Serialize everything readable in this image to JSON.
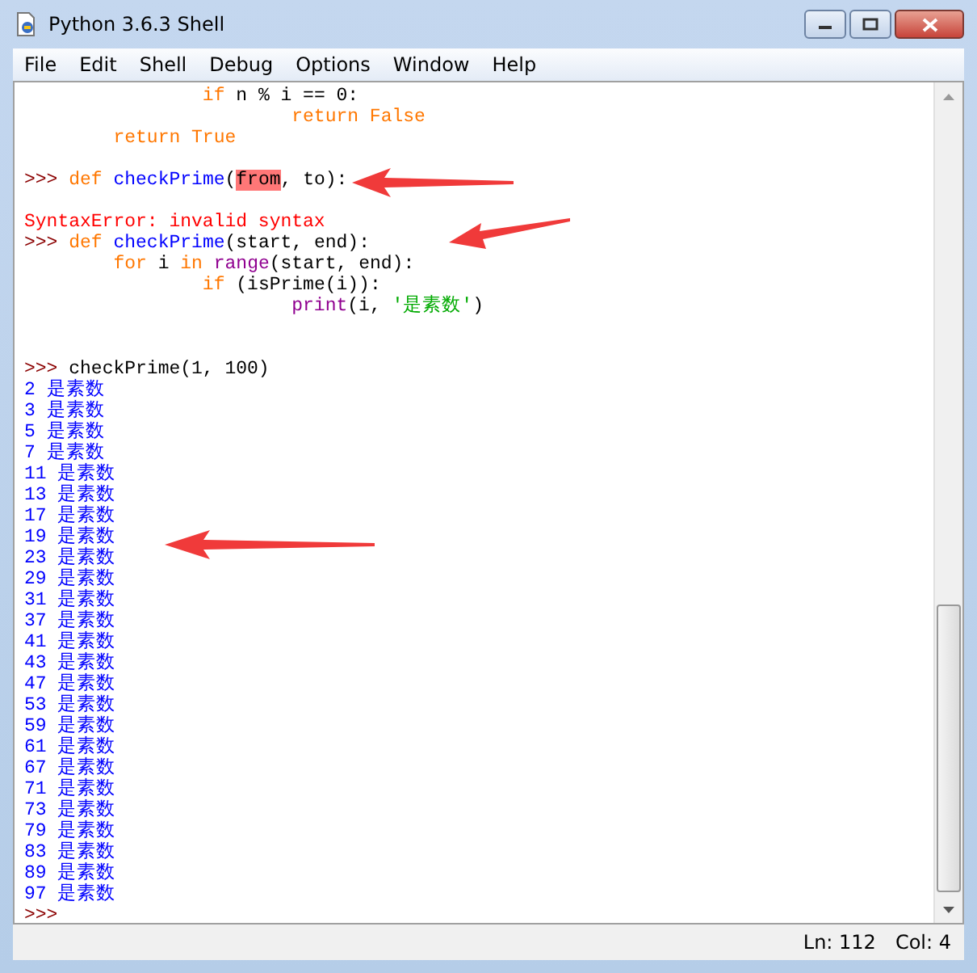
{
  "window": {
    "title": "Python 3.6.3 Shell"
  },
  "menu": [
    "File",
    "Edit",
    "Shell",
    "Debug",
    "Options",
    "Window",
    "Help"
  ],
  "lines": [
    {
      "kind": "code",
      "segments": [
        {
          "text": "                if",
          "kind": "keyword"
        },
        {
          "text": " n % i == 0:",
          "kind": "plain"
        }
      ]
    },
    {
      "kind": "code",
      "segments": [
        {
          "text": "                        return False",
          "kind": "keyword"
        }
      ]
    },
    {
      "kind": "code",
      "segments": [
        {
          "text": "        return True",
          "kind": "keyword"
        }
      ]
    },
    {
      "kind": "blank"
    },
    {
      "kind": "code",
      "segments": [
        {
          "text": ">>> ",
          "kind": "prompt"
        },
        {
          "text": "def",
          "kind": "keyword"
        },
        {
          "text": " checkPrime",
          "kind": "definition"
        },
        {
          "text": "(",
          "kind": "plain"
        },
        {
          "text": "from",
          "kind": "error-mark"
        },
        {
          "text": ", to):",
          "kind": "plain"
        }
      ]
    },
    {
      "kind": "blank"
    },
    {
      "kind": "code",
      "segments": [
        {
          "text": "SyntaxError: invalid syntax",
          "kind": "error"
        }
      ]
    },
    {
      "kind": "code",
      "segments": [
        {
          "text": ">>> ",
          "kind": "prompt"
        },
        {
          "text": "def",
          "kind": "keyword"
        },
        {
          "text": " checkPrime",
          "kind": "definition"
        },
        {
          "text": "(start, end):",
          "kind": "plain"
        }
      ]
    },
    {
      "kind": "code",
      "segments": [
        {
          "text": "        for",
          "kind": "keyword"
        },
        {
          "text": " i ",
          "kind": "plain"
        },
        {
          "text": "in ",
          "kind": "keyword"
        },
        {
          "text": "range",
          "kind": "builtin"
        },
        {
          "text": "(start, end):",
          "kind": "plain"
        }
      ]
    },
    {
      "kind": "code",
      "segments": [
        {
          "text": "                if",
          "kind": "keyword"
        },
        {
          "text": " (isPrime(i)):",
          "kind": "plain"
        }
      ]
    },
    {
      "kind": "code",
      "segments": [
        {
          "text": "                        print",
          "kind": "builtin"
        },
        {
          "text": "(i, ",
          "kind": "plain"
        },
        {
          "text": "'是素数'",
          "kind": "string"
        },
        {
          "text": ")",
          "kind": "plain"
        }
      ]
    },
    {
      "kind": "blank"
    },
    {
      "kind": "blank"
    },
    {
      "kind": "code",
      "segments": [
        {
          "text": ">>> ",
          "kind": "prompt"
        },
        {
          "text": "checkPrime(1, 100)",
          "kind": "plain"
        }
      ]
    },
    {
      "kind": "code",
      "segments": [
        {
          "text": "2 是素数",
          "kind": "output"
        }
      ]
    },
    {
      "kind": "code",
      "segments": [
        {
          "text": "3 是素数",
          "kind": "output"
        }
      ]
    },
    {
      "kind": "code",
      "segments": [
        {
          "text": "5 是素数",
          "kind": "output"
        }
      ]
    },
    {
      "kind": "code",
      "segments": [
        {
          "text": "7 是素数",
          "kind": "output"
        }
      ]
    },
    {
      "kind": "code",
      "segments": [
        {
          "text": "11 是素数",
          "kind": "output"
        }
      ]
    },
    {
      "kind": "code",
      "segments": [
        {
          "text": "13 是素数",
          "kind": "output"
        }
      ]
    },
    {
      "kind": "code",
      "segments": [
        {
          "text": "17 是素数",
          "kind": "output"
        }
      ]
    },
    {
      "kind": "code",
      "segments": [
        {
          "text": "19 是素数",
          "kind": "output"
        }
      ]
    },
    {
      "kind": "code",
      "segments": [
        {
          "text": "23 是素数",
          "kind": "output"
        }
      ]
    },
    {
      "kind": "code",
      "segments": [
        {
          "text": "29 是素数",
          "kind": "output"
        }
      ]
    },
    {
      "kind": "code",
      "segments": [
        {
          "text": "31 是素数",
          "kind": "output"
        }
      ]
    },
    {
      "kind": "code",
      "segments": [
        {
          "text": "37 是素数",
          "kind": "output"
        }
      ]
    },
    {
      "kind": "code",
      "segments": [
        {
          "text": "41 是素数",
          "kind": "output"
        }
      ]
    },
    {
      "kind": "code",
      "segments": [
        {
          "text": "43 是素数",
          "kind": "output"
        }
      ]
    },
    {
      "kind": "code",
      "segments": [
        {
          "text": "47 是素数",
          "kind": "output"
        }
      ]
    },
    {
      "kind": "code",
      "segments": [
        {
          "text": "53 是素数",
          "kind": "output"
        }
      ]
    },
    {
      "kind": "code",
      "segments": [
        {
          "text": "59 是素数",
          "kind": "output"
        }
      ]
    },
    {
      "kind": "code",
      "segments": [
        {
          "text": "61 是素数",
          "kind": "output"
        }
      ]
    },
    {
      "kind": "code",
      "segments": [
        {
          "text": "67 是素数",
          "kind": "output"
        }
      ]
    },
    {
      "kind": "code",
      "segments": [
        {
          "text": "71 是素数",
          "kind": "output"
        }
      ]
    },
    {
      "kind": "code",
      "segments": [
        {
          "text": "73 是素数",
          "kind": "output"
        }
      ]
    },
    {
      "kind": "code",
      "segments": [
        {
          "text": "79 是素数",
          "kind": "output"
        }
      ]
    },
    {
      "kind": "code",
      "segments": [
        {
          "text": "83 是素数",
          "kind": "output"
        }
      ]
    },
    {
      "kind": "code",
      "segments": [
        {
          "text": "89 是素数",
          "kind": "output"
        }
      ]
    },
    {
      "kind": "code",
      "segments": [
        {
          "text": "97 是素数",
          "kind": "output"
        }
      ]
    },
    {
      "kind": "code",
      "segments": [
        {
          "text": ">>>",
          "kind": "prompt"
        }
      ]
    }
  ],
  "status_bar": {
    "line": "Ln: 112",
    "column": "Col: 4"
  }
}
